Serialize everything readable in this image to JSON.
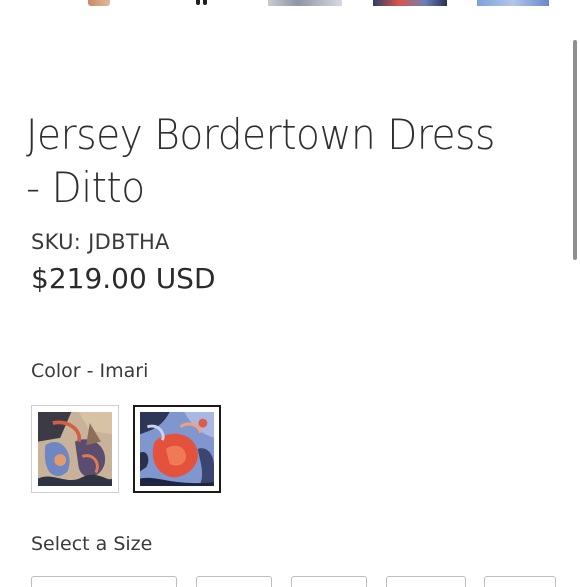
{
  "gallery": {
    "thumbnails": [
      "thumbnail-1",
      "thumbnail-2",
      "thumbnail-3",
      "thumbnail-4",
      "thumbnail-5"
    ]
  },
  "product": {
    "title": "Jersey Bordertown Dress - Ditto",
    "sku": "SKU: JDBTHA",
    "price": "$219.00 USD"
  },
  "color": {
    "label": "Color - Imari",
    "swatches": [
      {
        "name": "swatch-1",
        "selected": false
      },
      {
        "name": "swatch-2",
        "selected": true
      }
    ],
    "accent_selected_border": "#1a1a1a"
  },
  "size": {
    "label": "Select a Size"
  }
}
